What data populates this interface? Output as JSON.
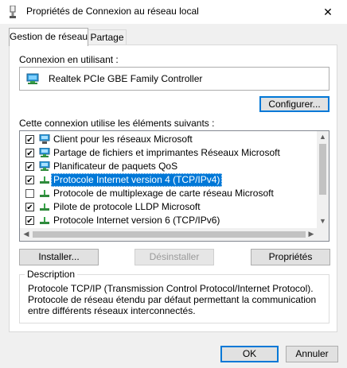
{
  "window": {
    "title": "Propriétés de Connexion au réseau local",
    "close_label": "✕"
  },
  "tabs": [
    {
      "label": "Gestion de réseau"
    },
    {
      "label": "Partage"
    }
  ],
  "connection": {
    "label": "Connexion en utilisant :",
    "adapter": "Realtek PCIe GBE Family Controller",
    "configure_button": "Configurer..."
  },
  "items": {
    "label": "Cette connexion utilise les éléments suivants :",
    "list": [
      {
        "label": "Client pour les réseaux Microsoft",
        "checked": true,
        "icon": "network-client-icon"
      },
      {
        "label": "Partage de fichiers et imprimantes Réseaux Microsoft",
        "checked": true,
        "icon": "network-service-icon"
      },
      {
        "label": "Planificateur de paquets QoS",
        "checked": true,
        "icon": "network-service-icon"
      },
      {
        "label": "Protocole Internet version 4 (TCP/IPv4)",
        "checked": true,
        "icon": "protocol-icon",
        "selected": true
      },
      {
        "label": "Protocole de multiplexage de carte réseau Microsoft",
        "checked": false,
        "icon": "protocol-icon"
      },
      {
        "label": "Pilote de protocole LLDP Microsoft",
        "checked": true,
        "icon": "protocol-icon"
      },
      {
        "label": "Protocole Internet version 6 (TCP/IPv6)",
        "checked": true,
        "icon": "protocol-icon"
      }
    ]
  },
  "buttons": {
    "install": "Installer...",
    "uninstall": "Désinstaller",
    "properties": "Propriétés",
    "ok": "OK",
    "cancel": "Annuler"
  },
  "description": {
    "title": "Description",
    "text": "Protocole TCP/IP (Transmission Control Protocol/Internet Protocol). Protocole de réseau étendu par défaut permettant la communication entre différents réseaux interconnectés."
  },
  "colors": {
    "accent": "#0078d7",
    "window_bg": "#f0f0f0"
  }
}
